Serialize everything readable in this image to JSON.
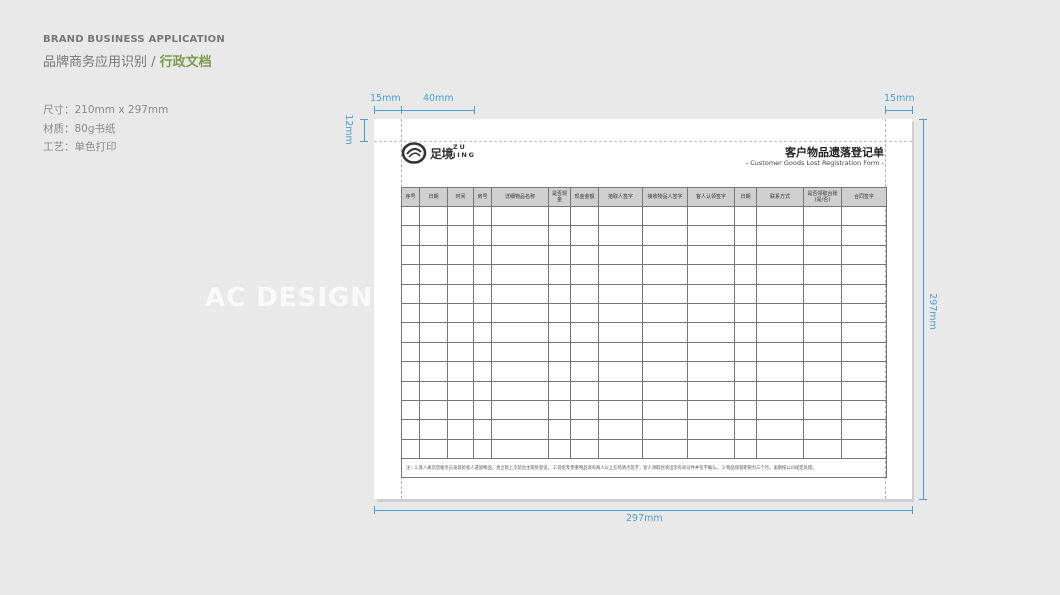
{
  "header": {
    "title_en": "BRAND BUSINESS APPLICATION",
    "title_cn_prefix": "品牌商务应用识别 / ",
    "title_cn_highlight": "行政文档"
  },
  "specs": [
    "尺寸：210mm x 297mm",
    "材质：80g书纸",
    "工艺：单色打印"
  ],
  "watermark": "AC DESIGN T",
  "dimensions": {
    "left_margin": "15mm",
    "logo_width": "40mm",
    "right_margin": "15mm",
    "top_margin": "12mm",
    "height": "297mm",
    "width": "297mm"
  },
  "logo": {
    "text_cn": "足境",
    "text_en_line1": "ZU",
    "text_en_line2": "JING"
  },
  "form": {
    "title": "客户物品遗落登记单",
    "subtitle": "- Customer Goods Lost Registration Form -",
    "columns": [
      "序号",
      "日期",
      "时间",
      "房号",
      "详细物品名称",
      "是否现金",
      "现金金额",
      "拾取人签字",
      "接收物品人签字",
      "客人认领签字",
      "日期",
      "联系方式",
      "是否领取台账(是/否)",
      "合同签字"
    ],
    "empty_rows": 13,
    "note": "注：1.客人离店后服务员发现的客人遗留物品，须立即上交前台主管处登记。  2.现金及贵重物品须有两人以上在场清点签字，客人领取时须出示有效证件并签字确认。  3.物品保管期限为三个月，逾期按公司规定处理。"
  }
}
